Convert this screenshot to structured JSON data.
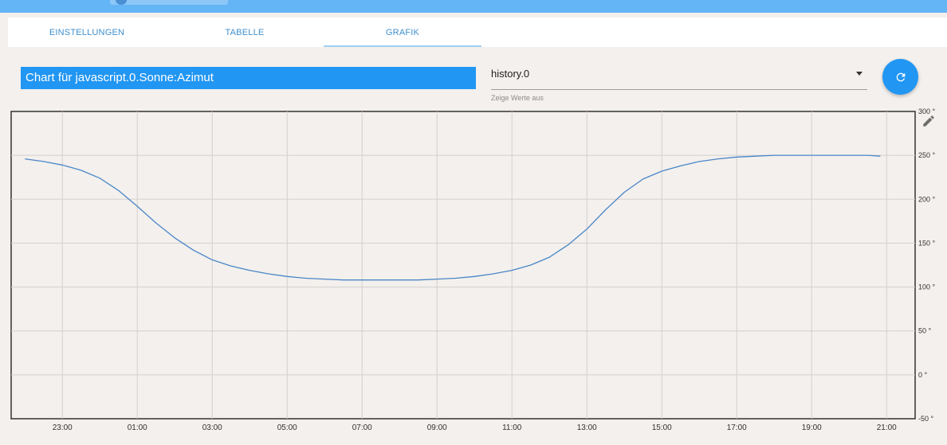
{
  "tabs": [
    {
      "label": "EINSTELLUNGEN"
    },
    {
      "label": "TABELLE"
    },
    {
      "label": "GRAFIK"
    }
  ],
  "active_tab": "GRAFIK",
  "chart_title": "Chart für javascript.0.Sonne:Azimut",
  "history_select": {
    "value": "history.0",
    "helper": "Zeige Werte aus"
  },
  "icons": {
    "refresh": "refresh-icon",
    "edit": "pencil-icon",
    "dropdown": "chevron-down-icon"
  },
  "colors": {
    "accent": "#2196f3",
    "line": "#4a86c8"
  },
  "chart_data": {
    "type": "line",
    "x": [
      "22:00",
      "22:30",
      "23:00",
      "23:30",
      "00:00",
      "00:30",
      "01:00",
      "01:30",
      "02:00",
      "02:30",
      "03:00",
      "03:30",
      "04:00",
      "04:30",
      "05:00",
      "05:30",
      "06:00",
      "06:30",
      "07:00",
      "07:30",
      "08:00",
      "08:30",
      "09:00",
      "09:30",
      "10:00",
      "10:30",
      "11:00",
      "11:30",
      "12:00",
      "12:30",
      "13:00",
      "13:30",
      "14:00",
      "14:30",
      "15:00",
      "15:30",
      "16:00",
      "16:30",
      "17:00",
      "17:30",
      "18:00",
      "18:30",
      "19:00",
      "19:30",
      "20:00",
      "20:30",
      "20:50"
    ],
    "series": [
      {
        "values": [
          246,
          243,
          239,
          233,
          224,
          210,
          192,
          173,
          156,
          142,
          131,
          124,
          119,
          115,
          112,
          110,
          109,
          108,
          108,
          108,
          108,
          108,
          109,
          110,
          112,
          115,
          119,
          125,
          134,
          148,
          166,
          188,
          208,
          223,
          232,
          238,
          243,
          246,
          248,
          249,
          250,
          250,
          250,
          250,
          250,
          250,
          249
        ]
      }
    ],
    "xticks": [
      "23:00",
      "01:00",
      "03:00",
      "05:00",
      "07:00",
      "09:00",
      "11:00",
      "13:00",
      "15:00",
      "17:00",
      "19:00",
      "21:00"
    ],
    "yticks": [
      "300 °",
      "250 °",
      "200 °",
      "150 °",
      "100 °",
      "50 °",
      "0 °",
      "-50 °"
    ],
    "ylim": [
      -50,
      300
    ],
    "grid": true,
    "yaxis_position": "right"
  }
}
